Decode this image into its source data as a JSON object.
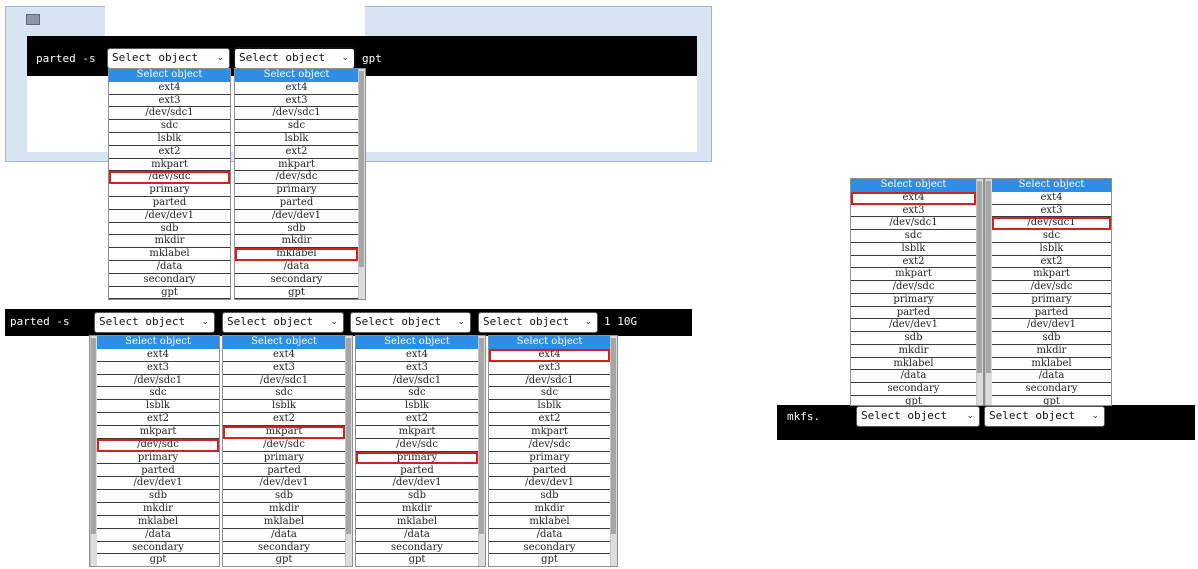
{
  "colors": {
    "terminal_bg": "#000000",
    "header_blue": "#2e8ee6",
    "highlight_red": "#d42020",
    "window_frame": "#d7e4f2"
  },
  "icons": {
    "window_icon": "terminal-window-icon",
    "chevron": "chevron-down-icon"
  },
  "select_placeholder": "Select object",
  "options": [
    "Select object",
    "ext4",
    "ext3",
    "/dev/sdc1",
    "sdc",
    "lsblk",
    "ext2",
    "mkpart",
    "/dev/sdc",
    "primary",
    "parted",
    "/dev/dev1",
    "sdb",
    "mkdir",
    "mklabel",
    "/data",
    "secondary",
    "gpt"
  ],
  "panel1": {
    "command": "parted -s",
    "suffix": "gpt",
    "highlights": [
      "/dev/sdc",
      "mklabel"
    ]
  },
  "panel2": {
    "command": "parted -s",
    "suffix": "1 10G",
    "highlights": [
      "/dev/sdc",
      "mkpart",
      "primary",
      "ext4"
    ]
  },
  "panel3": {
    "command": "mkfs.",
    "highlights": [
      "ext4",
      "/dev/sdc1"
    ]
  }
}
